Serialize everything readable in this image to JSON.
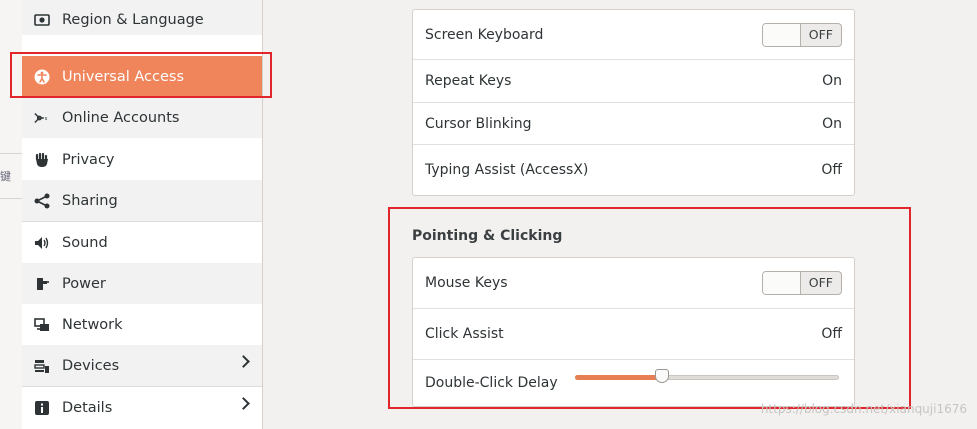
{
  "sidebar": {
    "items": [
      {
        "label": "Region & Language",
        "icon": "region-language-icon"
      },
      {
        "label": "Universal Access",
        "icon": "universal-access-icon",
        "active": true
      },
      {
        "label": "Online Accounts",
        "icon": "online-accounts-icon"
      },
      {
        "label": "Privacy",
        "icon": "privacy-hand-icon"
      },
      {
        "label": "Sharing",
        "icon": "sharing-icon"
      },
      {
        "label": "Sound",
        "icon": "speaker-icon"
      },
      {
        "label": "Power",
        "icon": "power-plug-icon"
      },
      {
        "label": "Network",
        "icon": "network-icon"
      },
      {
        "label": "Devices",
        "icon": "devices-icon"
      },
      {
        "label": "Details",
        "icon": "info-icon"
      }
    ]
  },
  "typing": {
    "rows": [
      {
        "label": "Screen Keyboard",
        "switch": "OFF"
      },
      {
        "label": "Repeat Keys",
        "value": "On"
      },
      {
        "label": "Cursor Blinking",
        "value": "On"
      },
      {
        "label": "Typing Assist (AccessX)",
        "value": "Off"
      }
    ]
  },
  "pointing": {
    "title": "Pointing & Clicking",
    "rows": [
      {
        "label": "Mouse Keys",
        "switch": "OFF"
      },
      {
        "label": "Click Assist",
        "value": "Off"
      },
      {
        "label": "Double-Click Delay",
        "slider_fraction": 0.33
      }
    ]
  },
  "left_edge": {
    "glyph": "键"
  },
  "watermark": "https://blog.csdn.net/xianquji1676",
  "colors": {
    "accent": "#f0845a",
    "annotation": "#e0262a",
    "slider_fill": "#e67f53"
  }
}
